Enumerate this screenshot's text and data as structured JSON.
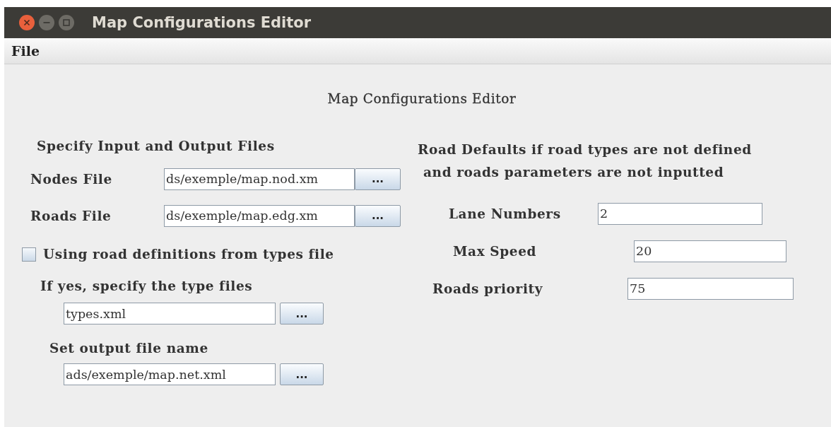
{
  "window": {
    "title": "Map Configurations Editor"
  },
  "menu": [
    {
      "label": "File"
    }
  ],
  "heading": "Map Configurations Editor",
  "files": {
    "title": "Specify Input and Output Files",
    "fields": [
      {
        "label": "Nodes File",
        "value": "ds/exemple/map.nod.xm",
        "button": "..."
      },
      {
        "label": "Roads File",
        "value": "ds/exemple/map.edg.xm",
        "button": "..."
      }
    ],
    "types_checkbox": {
      "label": "Using road definitions from types file",
      "checked": false
    },
    "types_prompt": "If yes, specify the type files",
    "types_field": {
      "value": "types.xml",
      "button": "..."
    },
    "output_prompt": "Set output file name",
    "output_field": {
      "value": "ads/exemple/map.net.xml",
      "button": "..."
    }
  },
  "defaults": {
    "title_lines": [
      "Road Defaults if road types are not defined",
      "and roads parameters are not inputted"
    ],
    "fields": [
      {
        "label": "Lane Numbers",
        "value": "2"
      },
      {
        "label": "Max Speed",
        "value": "20"
      },
      {
        "label": "Roads priority",
        "value": "75"
      }
    ]
  }
}
